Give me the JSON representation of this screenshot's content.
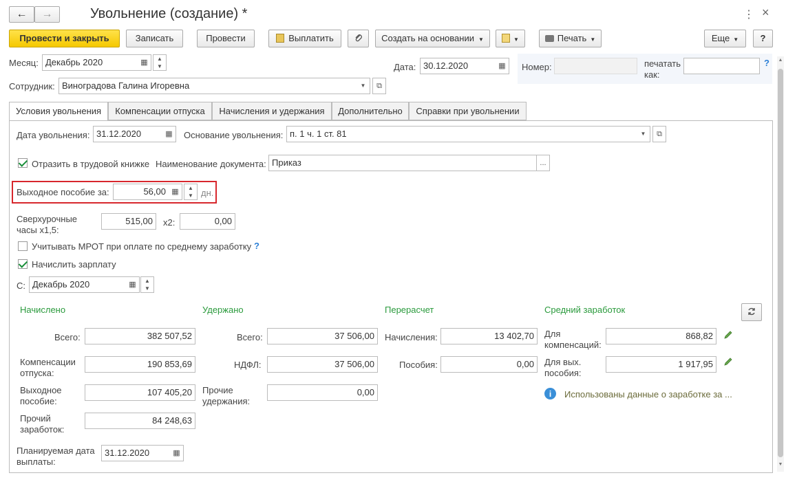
{
  "window": {
    "title": "Увольнение (создание) *",
    "back": "←",
    "forward": "→",
    "more": "⋮",
    "close": "×"
  },
  "toolbar": {
    "post_close": "Провести и закрыть",
    "save": "Записать",
    "post": "Провести",
    "pay": "Выплатить",
    "create_based": "Создать на основании",
    "print": "Печать",
    "more": "Еще",
    "help": "?"
  },
  "header": {
    "month_label": "Месяц:",
    "month_value": "Декабрь 2020",
    "date_label": "Дата:",
    "date_value": "30.12.2020",
    "number_label": "Номер:",
    "number_value": "",
    "print_as_label": "печатать как:",
    "print_as_value": "",
    "help": "?",
    "employee_label": "Сотрудник:",
    "employee_value": "Виноградова Галина Игоревна"
  },
  "tabs": [
    "Условия увольнения",
    "Компенсации отпуска",
    "Начисления и удержания",
    "Дополнительно",
    "Справки при увольнении"
  ],
  "conditions": {
    "dismissal_date_label": "Дата увольнения:",
    "dismissal_date": "31.12.2020",
    "reason_label": "Основание увольнения:",
    "reason": "п. 1 ч. 1 ст. 81",
    "workbook_label": "Отразить в трудовой книжке",
    "doc_name_label": "Наименование документа:",
    "doc_name": "Приказ",
    "severance_label": "Выходное пособие за:",
    "severance_days": "56,00",
    "days_unit": "дн.",
    "overtime_label": "Сверхурочные часы x1,5:",
    "overtime_15": "515,00",
    "x2_label": "x2:",
    "overtime_2": "0,00",
    "mrot_label": "Учитывать МРОТ при оплате по среднему заработку",
    "mrot_help": "?",
    "salary_label": "Начислить зарплату",
    "from_label": "С:",
    "from_value": "Декабрь 2020"
  },
  "accrued": {
    "title": "Начислено",
    "total_label": "Всего:",
    "total": "382 507,52",
    "vacation_label": "Компенсации отпуска:",
    "vacation": "190 853,69",
    "severance_label": "Выходное пособие:",
    "severance": "107 405,20",
    "other_label": "Прочий заработок:",
    "other": "84 248,63"
  },
  "withheld": {
    "title": "Удержано",
    "total_label": "Всего:",
    "total": "37 506,00",
    "ndfl_label": "НДФЛ:",
    "ndfl": "37 506,00",
    "other_label": "Прочие удержания:",
    "other": "0,00"
  },
  "recalc": {
    "title": "Перерасчет",
    "accruals_label": "Начисления:",
    "accruals": "13 402,70",
    "benefits_label": "Пособия:",
    "benefits": "0,00"
  },
  "average": {
    "title": "Средний заработок",
    "comp_label": "Для компенсаций:",
    "comp": "868,82",
    "sev_label": "Для вых. пособия:",
    "sev": "1 917,95",
    "info": "Использованы данные о заработке за ..."
  },
  "planned": {
    "label": "Планируемая дата выплаты:",
    "value": "31.12.2020"
  },
  "colors": {
    "accent_green": "#2a9a3c",
    "primary_yellow": "#f5c800",
    "highlight_red": "#d7262c"
  }
}
